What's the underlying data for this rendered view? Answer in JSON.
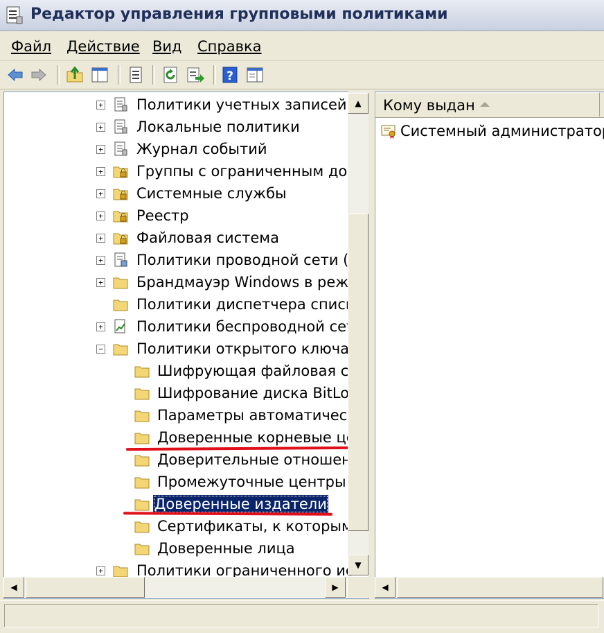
{
  "window": {
    "title": "Редактор управления групповыми политиками"
  },
  "menu": [
    {
      "label": "Файл"
    },
    {
      "label": "Действие"
    },
    {
      "label": "Вид"
    },
    {
      "label": "Справка"
    }
  ],
  "toolbar": {
    "buttons": [
      "back-icon",
      "forward-icon",
      "up-folder-icon",
      "show-hide-tree-icon",
      "properties-icon",
      "refresh-icon",
      "export-list-icon",
      "help-icon",
      "show-action-pane-icon"
    ]
  },
  "tree": {
    "items": [
      {
        "label": "Политики учетных записей",
        "expander": "+",
        "icon": "policy-sheet-icon"
      },
      {
        "label": "Локальные политики",
        "expander": "+",
        "icon": "policy-sheet-icon"
      },
      {
        "label": "Журнал событий",
        "expander": "+",
        "icon": "policy-sheet-icon"
      },
      {
        "label": "Группы с ограниченным дост",
        "expander": "+",
        "icon": "locked-folder-icon"
      },
      {
        "label": "Системные службы",
        "expander": "+",
        "icon": "locked-folder-icon"
      },
      {
        "label": "Реестр",
        "expander": "+",
        "icon": "locked-folder-icon"
      },
      {
        "label": "Файловая система",
        "expander": "+",
        "icon": "locked-folder-icon"
      },
      {
        "label": "Политики проводной сети (IE",
        "expander": "+",
        "icon": "network-policy-icon"
      },
      {
        "label": "Брандмауэр Windows в режим",
        "expander": "+",
        "icon": "folder-icon"
      },
      {
        "label": "Политики диспетчера списка",
        "expander": "",
        "icon": "folder-icon"
      },
      {
        "label": "Политики беспроводной сети",
        "expander": "+",
        "icon": "wireless-policy-icon"
      },
      {
        "label": "Политики открытого ключа",
        "expander": "−",
        "icon": "folder-icon"
      },
      {
        "label": "Шифрующая файловая сис",
        "expander": "",
        "icon": "folder-icon"
      },
      {
        "label": "Шифрование диска BitLock",
        "expander": "",
        "icon": "folder-icon"
      },
      {
        "label": "Параметры автоматическо",
        "expander": "",
        "icon": "folder-icon"
      },
      {
        "label": "Доверенные корневые цен",
        "expander": "",
        "icon": "folder-icon"
      },
      {
        "label": "Доверительные отношени",
        "expander": "",
        "icon": "folder-icon"
      },
      {
        "label": "Промежуточные центры с",
        "expander": "",
        "icon": "folder-icon"
      },
      {
        "label": "Доверенные издатели",
        "expander": "",
        "icon": "folder-icon",
        "selected": true
      },
      {
        "label": "Сертификаты, к которым",
        "expander": "",
        "icon": "folder-icon"
      },
      {
        "label": "Доверенные лица",
        "expander": "",
        "icon": "folder-icon"
      },
      {
        "label": "Политики ограниченного исп",
        "expander": "+",
        "icon": "folder-icon"
      }
    ]
  },
  "list": {
    "column_header": "Кому выдан",
    "rows": [
      {
        "label": "Системный администратор",
        "icon": "certificate-icon"
      }
    ]
  },
  "colors": {
    "selection": "#0a246a",
    "annotation_underline": "#e0101a",
    "folder": "#f3d777"
  }
}
